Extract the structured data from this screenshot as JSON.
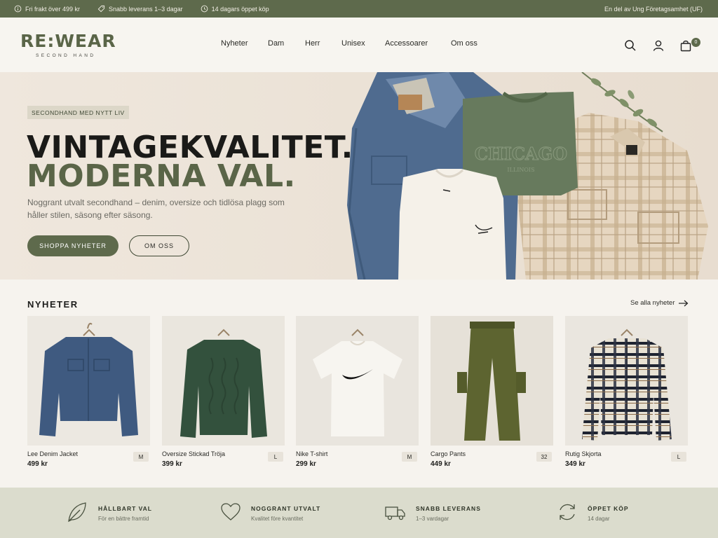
{
  "topbar": {
    "perks": [
      "Fri frakt över 499 kr",
      "Snabb leverans 1–3 dagar",
      "14 dagars öppet köp"
    ],
    "right_text": "En del av Ung Företagsamhet (UF)"
  },
  "header": {
    "logo_word": "RE:WEAR",
    "logo_sub": "SECOND HAND",
    "nav": [
      "Nyheter",
      "Dam",
      "Herr",
      "Unisex",
      "Accessoarer",
      "Om oss"
    ],
    "cart_count": "0"
  },
  "hero": {
    "badge": "SECONDHAND MED NYTT LIV",
    "headline_1": "VINTAGEKVALITET.",
    "headline_2": "MODERNA VAL.",
    "lead": "Noggrant utvalt secondhand – denim, oversize och tidlösa plagg som håller stilen, säsong efter säsong.",
    "cta_primary": "SHOPPA NYHETER",
    "cta_secondary": "OM OSS",
    "art": {
      "sweatshirt_print": "CHICAGO",
      "sweatshirt_sub": "ILLINOIS"
    }
  },
  "products_section": {
    "title": "NYHETER",
    "see_all": "Se alla nyheter",
    "items": [
      {
        "name": "Lee Denim Jacket",
        "price": "499 kr",
        "size": "M"
      },
      {
        "name": "Oversize Stickad Tröja",
        "price": "399 kr",
        "size": "L"
      },
      {
        "name": "Nike T-shirt",
        "price": "299 kr",
        "size": "M"
      },
      {
        "name": "Cargo Pants",
        "price": "449 kr",
        "size": "32"
      },
      {
        "name": "Rutig Skjorta",
        "price": "349 kr",
        "size": "L"
      }
    ]
  },
  "features": [
    {
      "title": "HÅLLBART VAL",
      "sub": "För en bättre framtid",
      "icon": "leaf-icon"
    },
    {
      "title": "NOGGRANT UTVALT",
      "sub": "Kvalitet före kvantitet",
      "icon": "heart-icon"
    },
    {
      "title": "SNABB LEVERANS",
      "sub": "1–3 vardagar",
      "icon": "truck-icon"
    },
    {
      "title": "ÖPPET KÖP",
      "sub": "14 dagar",
      "icon": "return-icon"
    }
  ],
  "colors": {
    "brand_green": "#5e6a4c",
    "hero_bg": "#ece3d8",
    "features_bg": "#dbdccd"
  }
}
